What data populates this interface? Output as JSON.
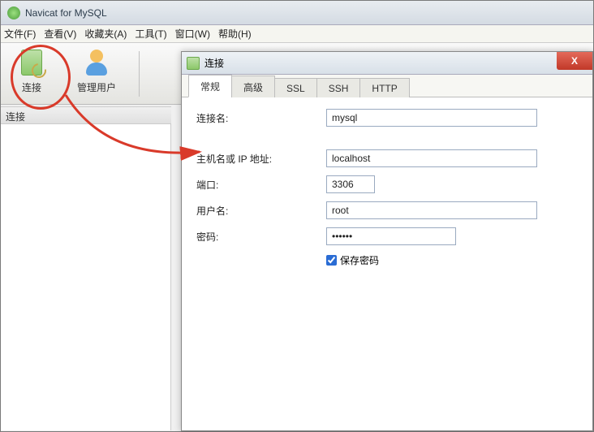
{
  "app": {
    "title": "Navicat for MySQL"
  },
  "menu": {
    "file": "文件(F)",
    "view": "查看(V)",
    "fav": "收藏夹(A)",
    "tools": "工具(T)",
    "window": "窗口(W)",
    "help": "帮助(H)"
  },
  "toolbar": {
    "connect": "连接",
    "manage_users": "管理用户"
  },
  "sidebar": {
    "header": "连接"
  },
  "dialog": {
    "title": "连接",
    "tabs": {
      "general": "常规",
      "advanced": "高级",
      "ssl": "SSL",
      "ssh": "SSH",
      "http": "HTTP"
    },
    "labels": {
      "conn_name": "连接名:",
      "host": "主机名或 IP 地址:",
      "port": "端口:",
      "user": "用户名:",
      "password": "密码:",
      "save_pw": "保存密码"
    },
    "values": {
      "conn_name": "mysql",
      "host": "localhost",
      "port": "3306",
      "user": "root",
      "password": "••••••"
    },
    "close": "X"
  }
}
